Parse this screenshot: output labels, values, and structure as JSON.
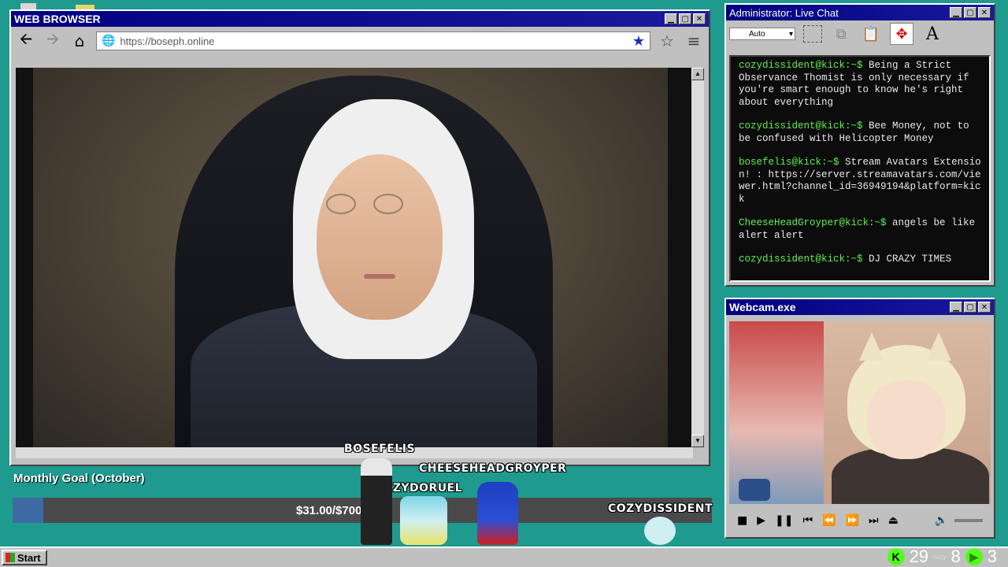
{
  "browser": {
    "title": "WEB BROWSER",
    "url": "https://boseph.online",
    "min": "▁",
    "max": "▢",
    "close": "✕"
  },
  "chat": {
    "title": "Administrator: Live Chat",
    "font_select": "Auto",
    "messages": [
      {
        "user": "cozydissident@kick:~$",
        "text": "Being a Strict Observance Thomist is only necessary if you're smart enough to know he's right about everything"
      },
      {
        "user": "cozydissident@kick:~$",
        "text": "Bee Money, not to be confused with Helicopter Money"
      },
      {
        "user": "bosefelis@kick:~$",
        "text": "Stream Avatars Extension! : https://server.streamavatars.com/viewer.html?channel_id=36949194&platform=kick"
      },
      {
        "user": "CheeseHeadGroyper@kick:~$",
        "text": "angels be like alert alert"
      },
      {
        "user": "cozydissident@kick:~$",
        "text": "DJ CRAZY TIMES"
      }
    ]
  },
  "webcam": {
    "title": "Webcam.exe"
  },
  "goal": {
    "label": "Monthly Goal (October)",
    "amount_text": "$31.00/$700.00",
    "progress": 0.044
  },
  "avatars": [
    {
      "name": "BOSEFELIS"
    },
    {
      "name": "CHEESEHEADGROYPER"
    },
    {
      "name": "IZYDORUEL"
    },
    {
      "name": "COZYDISSIDENT"
    }
  ],
  "taskbar": {
    "start_label": "Start",
    "tray_count_1": "29",
    "tray_mini_label": "cozy",
    "tray_count_2": "8",
    "tray_count_3": "3",
    "kick_color": "#53fc18"
  }
}
